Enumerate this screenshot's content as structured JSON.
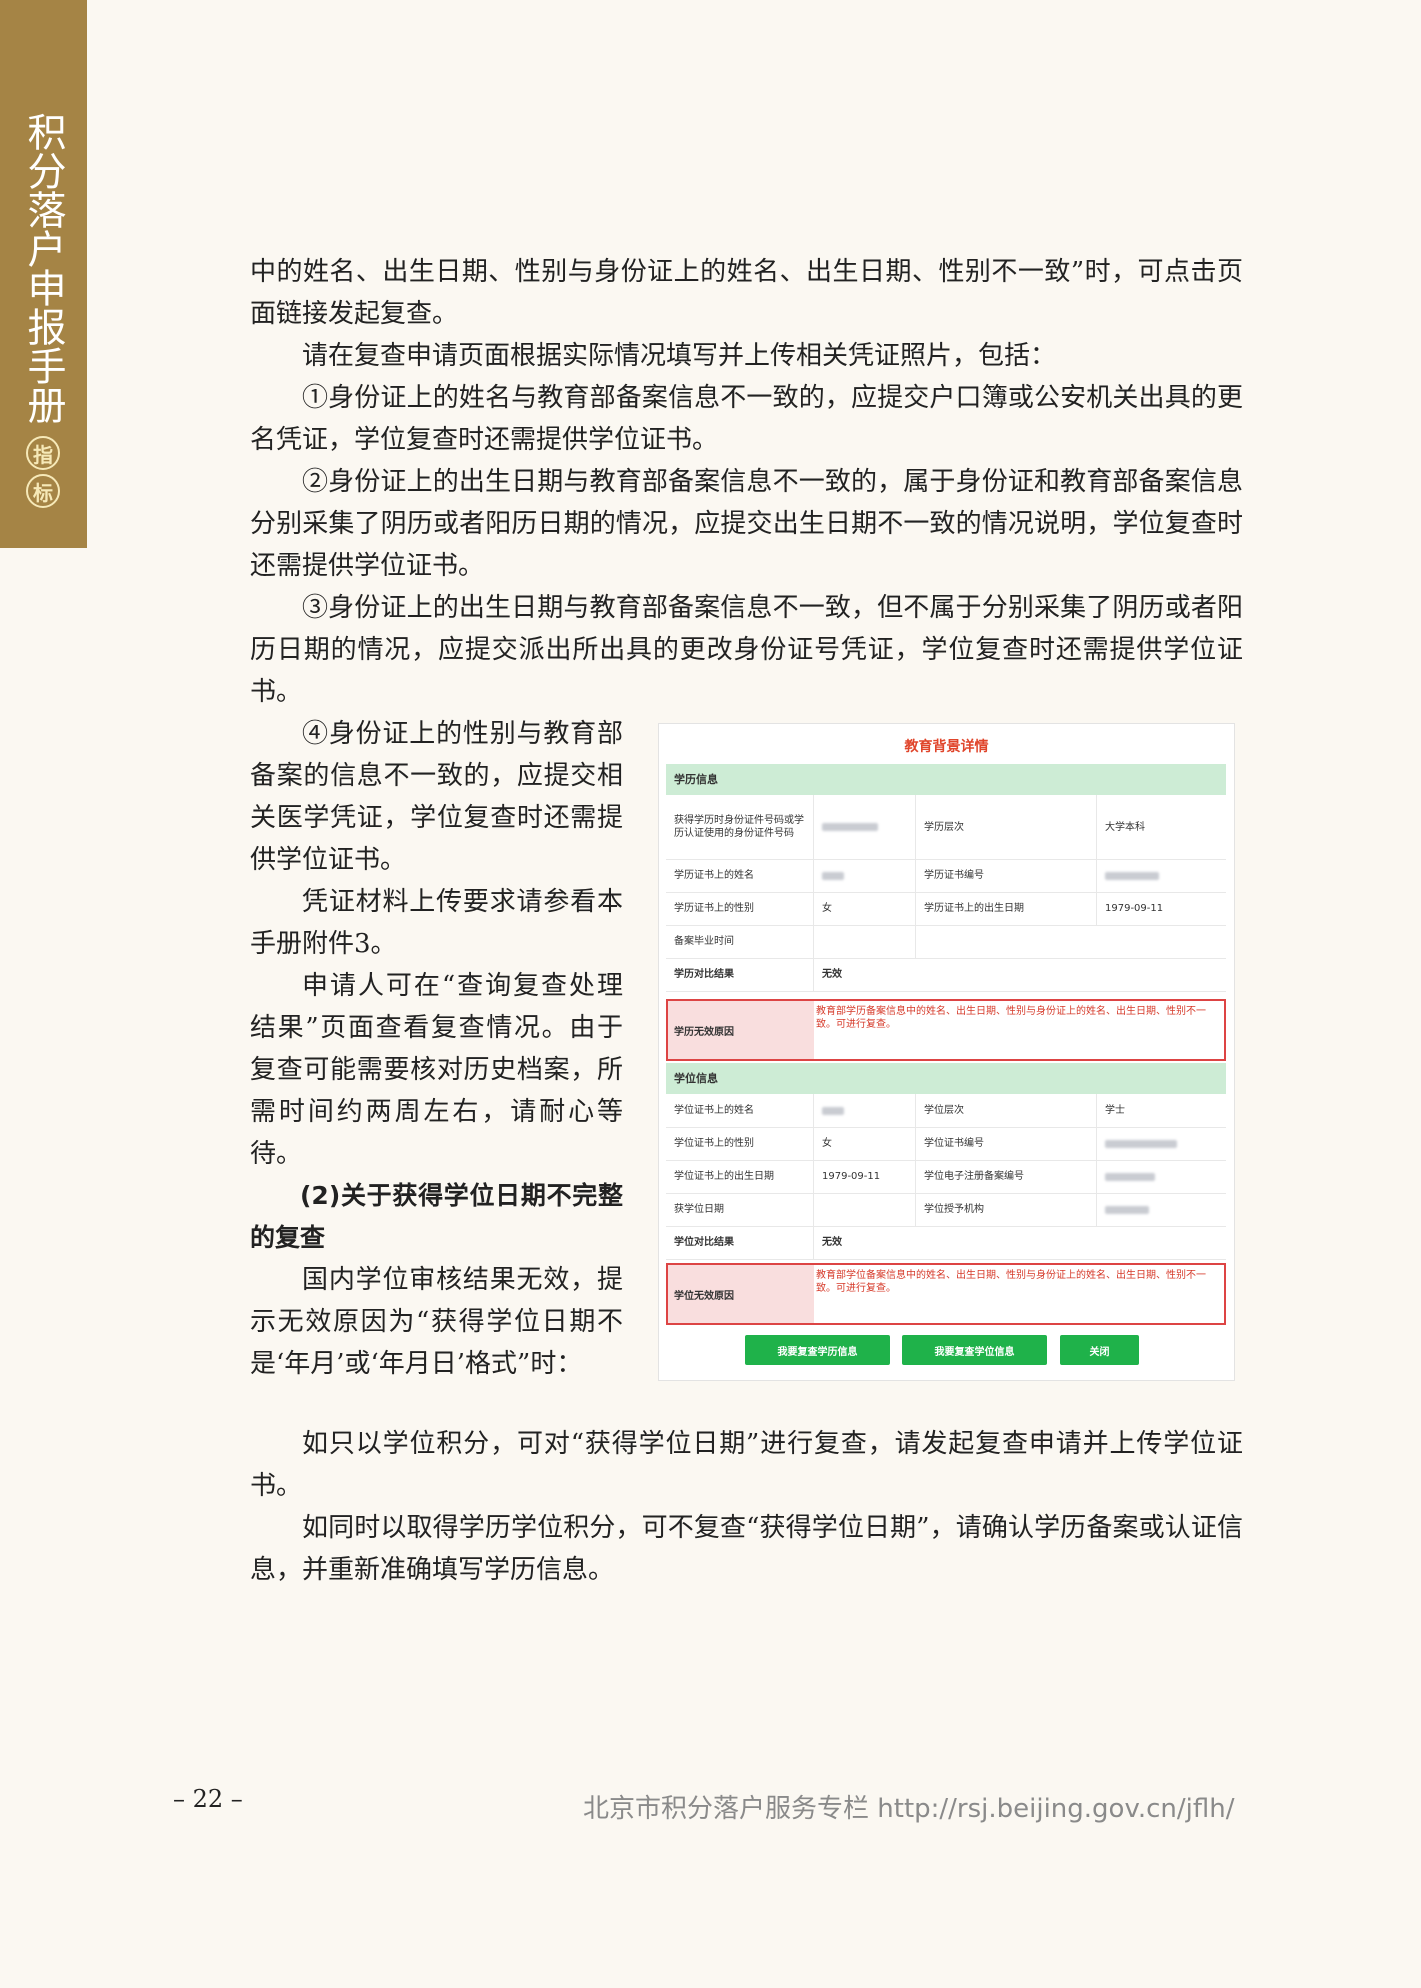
{
  "sidebar": {
    "title": "积分落户申报手册",
    "badge1": "指",
    "badge2": "标"
  },
  "top_paragraphs": [
    "中的姓名、出生日期、性别与身份证上的姓名、出生日期、性别不一致”时，可点击页面链接发起复查。",
    "请在复查申请页面根据实际情况填写并上传相关凭证照片，包括：",
    "①身份证上的姓名与教育部备案信息不一致的，应提交户口簿或公安机关出具的更名凭证，学位复查时还需提供学位证书。",
    "②身份证上的出生日期与教育部备案信息不一致的，属于身份证和教育部备案信息分别采集了阴历或者阳历日期的情况，应提交出生日期不一致的情况说明，学位复查时还需提供学位证书。",
    "③身份证上的出生日期与教育部备案信息不一致，但不属于分别采集了阴历或者阳历日期的情况，应提交派出所出具的更改身份证号凭证，学位复查时还需提供学位证书。"
  ],
  "left_column": {
    "p1": "④身份证上的性别与教育部备案的信息不一致的，应提交相关医学凭证，学位复查时还需提供学位证书。",
    "p2": "凭证材料上传要求请参看本手册附件3。",
    "p3": "申请人可在“查询复查处理结果”页面查看复查情况。由于复查可能需要核对历史档案，所需时间约两周左右，请耐心等待。",
    "heading": "(2)关于获得学位日期不完整的复查",
    "p4": "国内学位审核结果无效，提示无效原因为“获得学位日期不是‘年月’或‘年月日’格式”时："
  },
  "bottom_paragraphs": [
    "如只以学位积分，可对“获得学位日期”进行复查，请发起复查申请并上传学位证书。",
    "如同时以取得学历学位积分，可不复查“获得学位日期”，请确认学历备案或认证信息，并重新准确填写学历信息。"
  ],
  "panel": {
    "title": "教育背景详情",
    "edu_section": "学历信息",
    "edu_rows": {
      "id_label": "获得学历时身份证件号码或学历认证使用的身份证件号码",
      "level_label": "学历层次",
      "level_value": "大学本科",
      "name_label": "学历证书上的姓名",
      "cert_no_label": "学历证书编号",
      "gender_label": "学历证书上的性别",
      "gender_value": "女",
      "birth_label": "学历证书上的出生日期",
      "birth_value": "1979-09-11",
      "grad_label": "备案毕业时间",
      "compare_label": "学历对比结果",
      "compare_value": "无效",
      "reason_label": "学历无效原因",
      "reason_text": "教育部学历备案信息中的姓名、出生日期、性别与身份证上的姓名、出生日期、性别不一致。可进行复查。"
    },
    "deg_section": "学位信息",
    "deg_rows": {
      "name_label": "学位证书上的姓名",
      "level_label": "学位层次",
      "level_value": "学士",
      "gender_label": "学位证书上的性别",
      "gender_value": "女",
      "cert_no_label": "学位证书编号",
      "birth_label": "学位证书上的出生日期",
      "birth_value": "1979-09-11",
      "reg_label": "学位电子注册备案编号",
      "date_label": "获学位日期",
      "org_label": "学位授予机构",
      "compare_label": "学位对比结果",
      "compare_value": "无效",
      "reason_label": "学位无效原因",
      "reason_text": "教育部学位备案信息中的姓名、出生日期、性别与身份证上的姓名、出生日期、性别不一致。可进行复查。"
    },
    "buttons": {
      "edu": "我要复查学历信息",
      "deg": "我要复查学位信息",
      "close": "关闭"
    }
  },
  "footer": {
    "page": "– 22 –",
    "site": "北京市积分落户服务专栏   http://rsj.beijing.gov.cn/jflh/"
  }
}
